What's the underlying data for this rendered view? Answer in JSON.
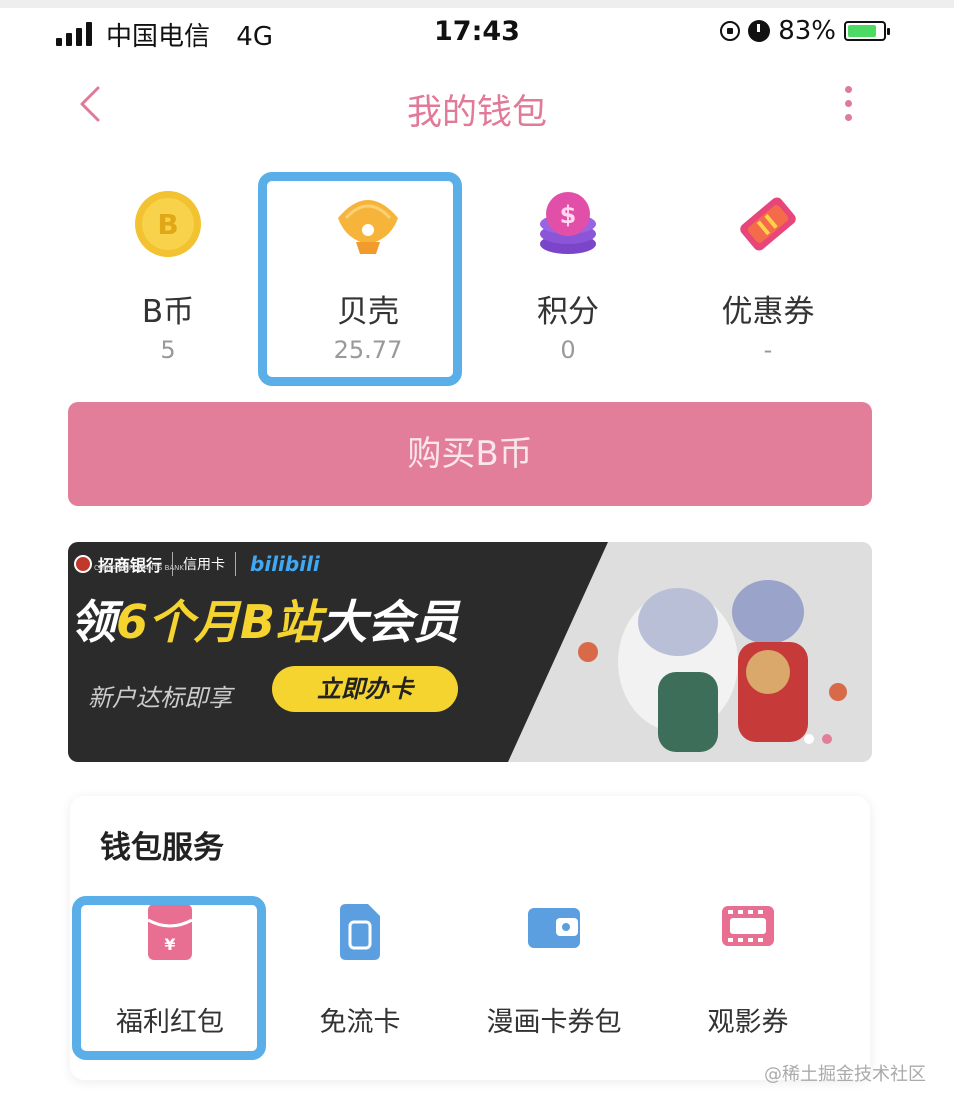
{
  "status_bar": {
    "carrier": "中国电信",
    "network": "4G",
    "time": "17:43",
    "battery_percent": "83%",
    "battery_level": 0.83
  },
  "nav": {
    "title": "我的钱包",
    "back_icon": "chevron-left-icon",
    "more_icon": "more-vertical-icon"
  },
  "assets": [
    {
      "label": "B币",
      "value": "5",
      "icon": "b-coin-icon"
    },
    {
      "label": "贝壳",
      "value": "25.77",
      "icon": "shell-icon"
    },
    {
      "label": "积分",
      "value": "0",
      "icon": "points-coins-icon"
    },
    {
      "label": "优惠券",
      "value": "-",
      "icon": "coupon-ticket-icon"
    }
  ],
  "buy_button": {
    "label": "购买B币"
  },
  "banner": {
    "bank_name": "招商银行",
    "bank_name_en": "CHINA MERCHANTS BANK",
    "card_label": "信用卡",
    "partner": "bilibili",
    "headline_1": "领",
    "headline_2": "6个月B站",
    "headline_3": "大会员",
    "subtext": "新户达标即享",
    "cta": "立即办卡",
    "active_slide": 2,
    "slide_count": 2
  },
  "wallet_services": {
    "title": "钱包服务",
    "items": [
      {
        "label": "福利红包",
        "icon": "red-envelope-icon"
      },
      {
        "label": "免流卡",
        "icon": "sim-card-icon"
      },
      {
        "label": "漫画卡券包",
        "icon": "wallet-icon"
      },
      {
        "label": "观影券",
        "icon": "film-ticket-icon"
      }
    ]
  },
  "watermark": "@稀土掘金技术社区",
  "colors": {
    "accent_pink": "#e27d9a",
    "highlight_blue": "#5aafe8",
    "coin_gold": "#f2c230",
    "service_blue": "#5b9fe0"
  }
}
